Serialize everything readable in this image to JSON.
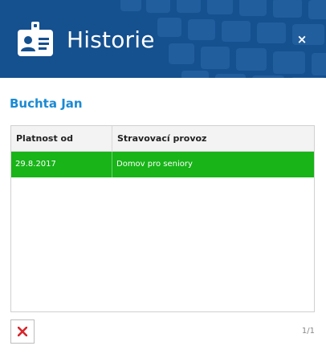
{
  "dialog": {
    "title": "Historie",
    "icon": "id-card-icon",
    "close_symbol": "×"
  },
  "person": {
    "name": "Buchta Jan"
  },
  "table": {
    "columns": [
      "Platnost od",
      "Stravovací provoz"
    ],
    "rows": [
      {
        "valid_from": "29.8.2017",
        "canteen": "Domov pro seniory",
        "selected": true
      }
    ]
  },
  "footer": {
    "delete_icon": "delete-x-icon",
    "pagination": "1/1"
  },
  "colors": {
    "header_bg": "#15508f",
    "name_color": "#1a8ad4",
    "selected_row": "#18b418",
    "delete_red": "#d9252a"
  }
}
